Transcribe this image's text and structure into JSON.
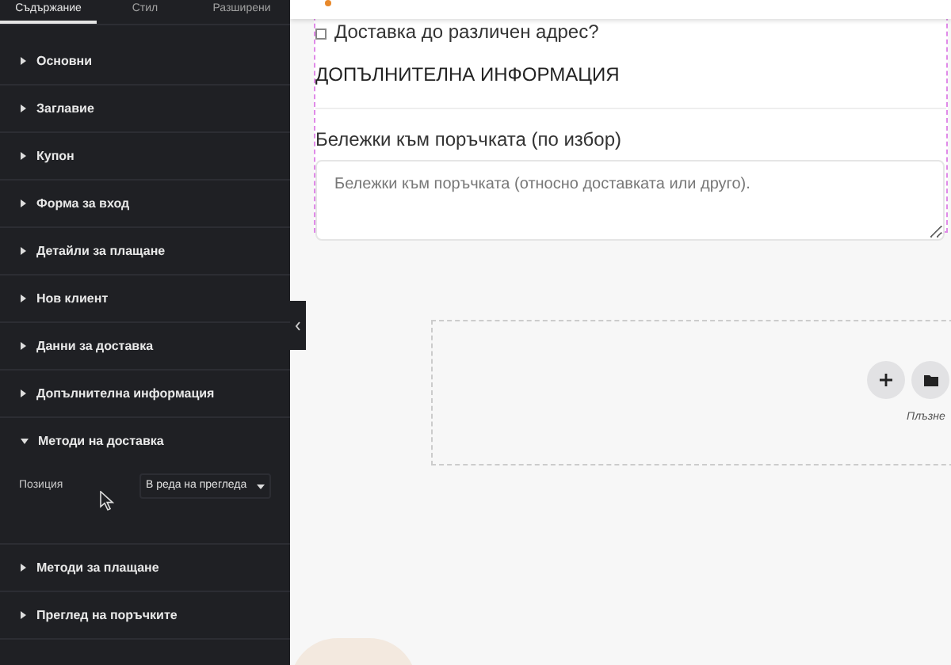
{
  "panel": {
    "tabs": [
      {
        "label": "Съдържание",
        "selected": true
      },
      {
        "label": "Стил",
        "selected": false
      },
      {
        "label": "Разширени",
        "selected": false
      }
    ],
    "sections": [
      {
        "label": "Основни",
        "expanded": false
      },
      {
        "label": "Заглавие",
        "expanded": false
      },
      {
        "label": "Купон",
        "expanded": false
      },
      {
        "label": "Форма за вход",
        "expanded": false
      },
      {
        "label": "Детайли за плащане",
        "expanded": false
      },
      {
        "label": "Нов клиент",
        "expanded": false
      },
      {
        "label": "Данни за доставка",
        "expanded": false
      },
      {
        "label": "Допълнителна информация",
        "expanded": false
      },
      {
        "label": "Методи на доставка",
        "expanded": true,
        "controls": [
          {
            "label": "Позиция",
            "value": "В реда на прегледа"
          }
        ]
      },
      {
        "label": "Методи за плащане",
        "expanded": false
      },
      {
        "label": "Преглед на поръчките",
        "expanded": false
      }
    ]
  },
  "canvas": {
    "checkbox": {
      "label": "Доставка до различен адрес?",
      "checked": false
    },
    "heading": "ДОПЪЛНИТЕЛНА ИНФОРМАЦИЯ",
    "notes_label": "Бележки към поръчката (по избор)",
    "notes_placeholder": "Бележки към поръчката (относно доставката или друго).",
    "drop_zone_text": "Плъзне"
  }
}
